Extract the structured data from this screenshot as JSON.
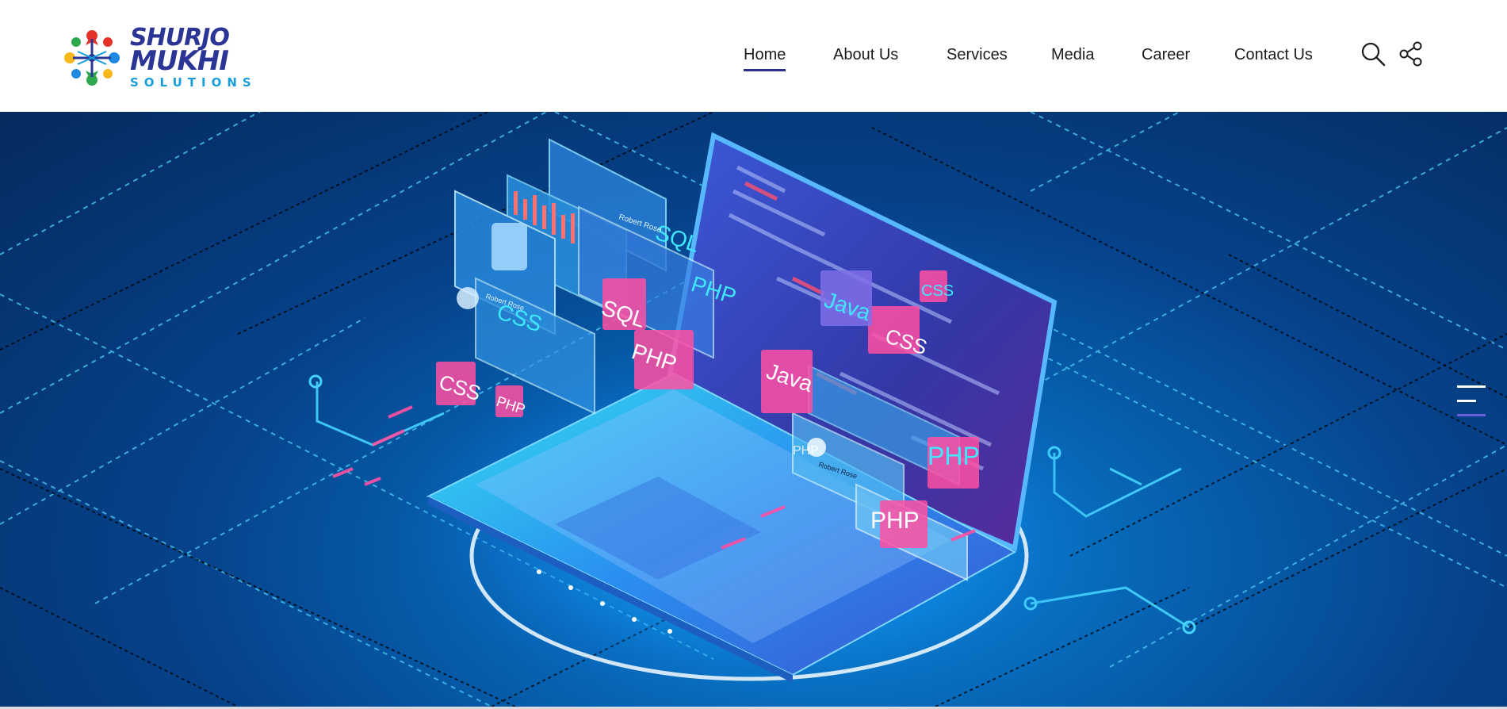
{
  "brand": {
    "line1": "SHURJO",
    "line2": "MUKHI",
    "line3": "SOLUTIONS",
    "colors": {
      "navy": "#2b3595",
      "cyan": "#1a9ed9",
      "red": "#e63329",
      "green": "#2fa84f",
      "yellow": "#f6b81a",
      "blue": "#1e88e5"
    }
  },
  "nav": {
    "items": [
      {
        "label": "Home",
        "active": true
      },
      {
        "label": "About Us",
        "active": false
      },
      {
        "label": "Services",
        "active": false
      },
      {
        "label": "Media",
        "active": false
      },
      {
        "label": "Career",
        "active": false
      },
      {
        "label": "Contact Us",
        "active": false
      }
    ],
    "icons": [
      "search-icon",
      "share-icon"
    ],
    "active_color": "#2b2f8f"
  },
  "hero": {
    "floating_tags": [
      "SQL",
      "PHP",
      "Java",
      "CSS",
      "CSS",
      "SQL",
      "CSS",
      "PHP",
      "PHP",
      "PHP",
      "Java",
      "CSS",
      "PHP",
      "PHP"
    ],
    "card_captions": [
      "Robert Rose",
      "Robert Rose",
      "Robert Rose"
    ],
    "menu_icon": "hamburger-menu-icon",
    "colors": {
      "deep": "#052a5e",
      "glow": "#0a8fe0",
      "pink": "#ff4fa3",
      "cyan": "#3ee8ff"
    }
  }
}
